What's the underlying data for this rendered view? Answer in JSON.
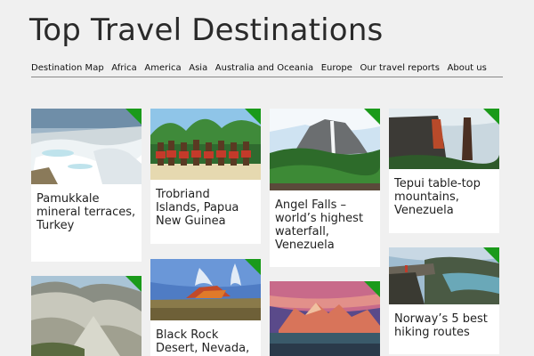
{
  "site": {
    "title": "Top Travel Destinations"
  },
  "nav": {
    "items": [
      "Destination Map",
      "Africa",
      "America",
      "Asia",
      "Australia and Oceania",
      "Europe",
      "Our travel reports",
      "About us"
    ]
  },
  "cards": [
    {
      "title": "Pamukkale mineral terraces, Turkey"
    },
    {
      "title": "Trobriand Islands, Papua New Guinea"
    },
    {
      "title": "Angel Falls – world’s highest waterfall, Venezuela"
    },
    {
      "title": "Tepui table-top mountains, Venezuela"
    },
    {
      "title": ""
    },
    {
      "title": "Black Rock Desert, Nevada,"
    },
    {
      "title": ""
    },
    {
      "title": "Norway’s 5 best hiking routes"
    }
  ],
  "colors": {
    "accent": "#1a9a1a",
    "background": "#f0f0f0"
  }
}
